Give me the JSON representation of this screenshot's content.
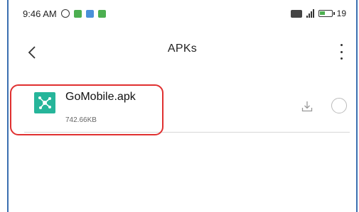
{
  "status_bar": {
    "time": "9:46 AM",
    "battery_text": "19"
  },
  "app_bar": {
    "title": "APKs"
  },
  "files": [
    {
      "name": "GoMobile.apk",
      "size": "742.66KB"
    }
  ],
  "colors": {
    "file_icon": "#26b59a",
    "highlight": "#e03030"
  }
}
